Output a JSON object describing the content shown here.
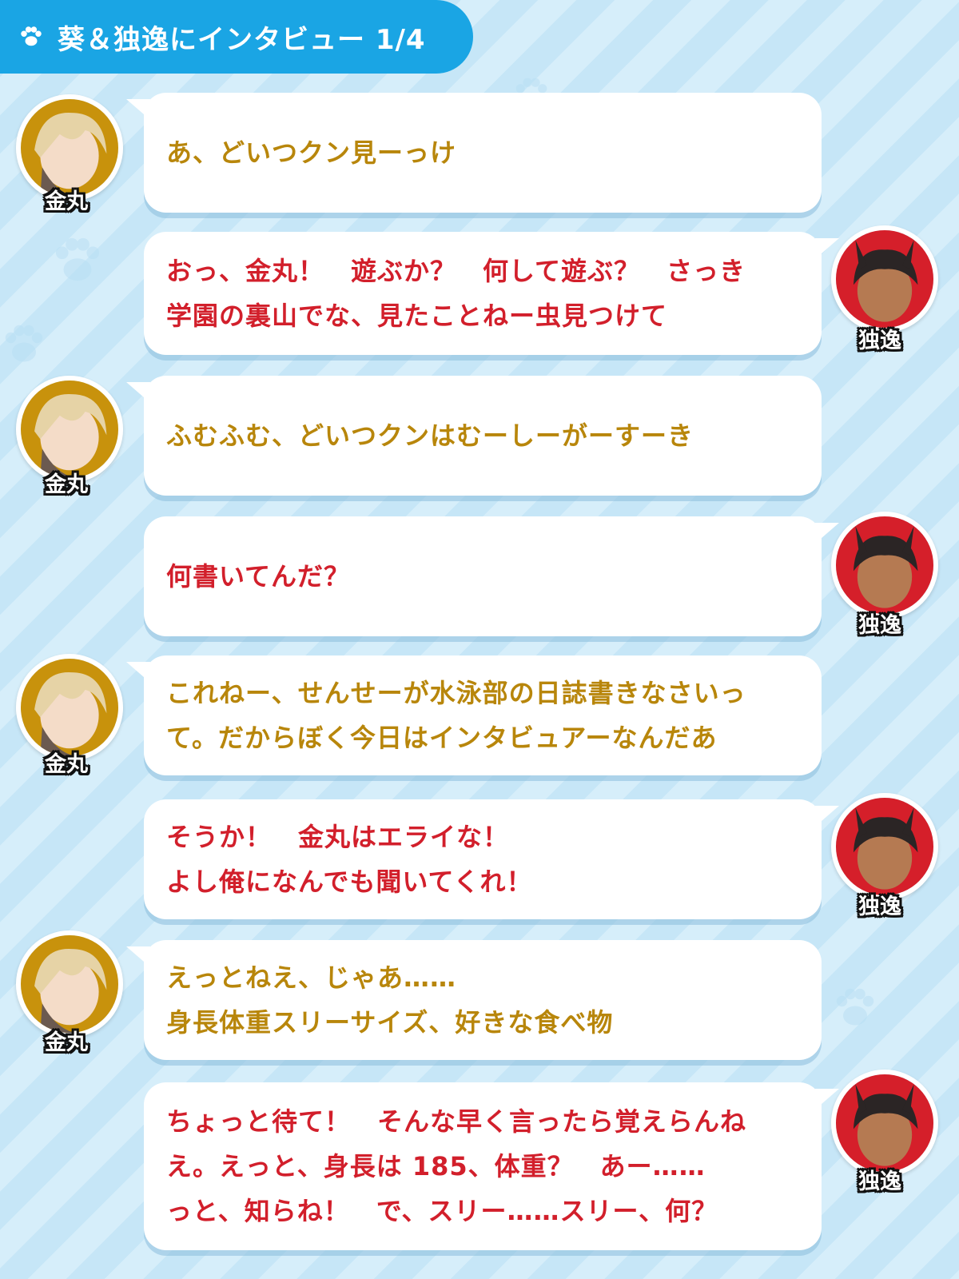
{
  "header": {
    "title": "葵＆独逸にインタビュー 1/4",
    "color": "#1aa5e4"
  },
  "characters": {
    "kin": {
      "name": "金丸",
      "ring_color": "#c8920c",
      "text_color": "#b8860b"
    },
    "doi": {
      "name": "独逸",
      "ring_color": "#d51f2a",
      "text_color": "#d21f2b"
    }
  },
  "messages": [
    {
      "speaker": "kin",
      "text": "あ、どいつクン見ーっけ"
    },
    {
      "speaker": "doi",
      "text": "おっ、金丸！　遊ぶか？　何して遊ぶ？　さっき\n学園の裏山でな、見たことねー虫見つけて"
    },
    {
      "speaker": "kin",
      "text": "ふむふむ、どいつクンはむーしーがーすーき"
    },
    {
      "speaker": "doi",
      "text": "何書いてんだ？"
    },
    {
      "speaker": "kin",
      "text": "これねー、せんせーが水泳部の日誌書きなさいっ\nて。だからぼく今日はインタビュアーなんだあ"
    },
    {
      "speaker": "doi",
      "text": "そうか！　金丸はエライな！\nよし俺になんでも聞いてくれ！"
    },
    {
      "speaker": "kin",
      "text": "えっとねえ、じゃあ……\n身長体重スリーサイズ、好きな食べ物"
    },
    {
      "speaker": "doi",
      "text": "ちょっと待て！　そんな早く言ったら覚えらんね\nえ。えっと、身長は 185、体重？　あー……\nっと、知らね！　で、スリー……スリー、何？"
    }
  ]
}
